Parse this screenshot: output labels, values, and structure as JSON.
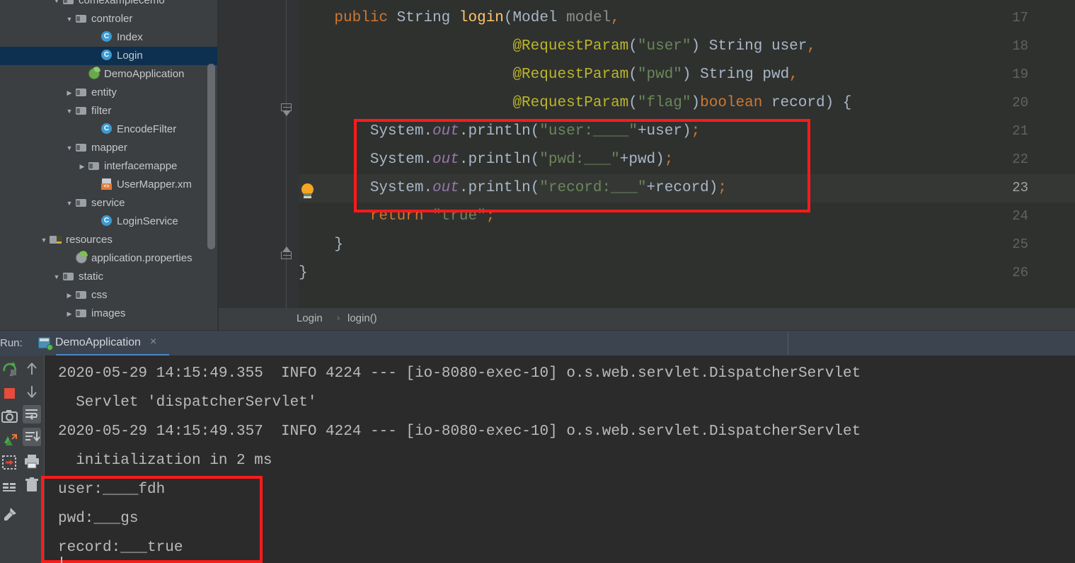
{
  "ide": {
    "theme_bg": "#3c3f41",
    "editor_bg": "#2f312f",
    "console_bg": "#2b2b2b",
    "selection_bg": "#0d3050",
    "accent": "#4a88c7",
    "highlight_box_color": "#ff1a1a"
  },
  "project_tree": [
    {
      "indent": 4,
      "arrow": "▼",
      "icon": "folder-icon",
      "label": "comexamplecemo",
      "partial": true,
      "selected": false
    },
    {
      "indent": 5,
      "arrow": "▼",
      "icon": "folder-icon",
      "label": "controler",
      "selected": false
    },
    {
      "indent": 7,
      "arrow": "",
      "icon": "class-icon",
      "label": "Index",
      "selected": false
    },
    {
      "indent": 7,
      "arrow": "",
      "icon": "class-icon",
      "label": "Login",
      "selected": true
    },
    {
      "indent": 6,
      "arrow": "",
      "icon": "spring-app-icon",
      "label": "DemoApplication",
      "selected": false
    },
    {
      "indent": 5,
      "arrow": "▶",
      "icon": "folder-icon",
      "label": "entity",
      "selected": false
    },
    {
      "indent": 5,
      "arrow": "▼",
      "icon": "folder-icon",
      "label": "filter",
      "selected": false
    },
    {
      "indent": 7,
      "arrow": "",
      "icon": "class-icon",
      "label": "EncodeFilter",
      "selected": false
    },
    {
      "indent": 5,
      "arrow": "▼",
      "icon": "folder-icon",
      "label": "mapper",
      "selected": false
    },
    {
      "indent": 6,
      "arrow": "▶",
      "icon": "folder-icon",
      "label": "interfacemappe",
      "selected": false
    },
    {
      "indent": 7,
      "arrow": "",
      "icon": "xml-file-icon",
      "label": "UserMapper.xm",
      "selected": false
    },
    {
      "indent": 5,
      "arrow": "▼",
      "icon": "folder-icon",
      "label": "service",
      "selected": false
    },
    {
      "indent": 7,
      "arrow": "",
      "icon": "class-icon",
      "label": "LoginService",
      "selected": false
    },
    {
      "indent": 3,
      "arrow": "▼",
      "icon": "resources-icon",
      "label": "resources",
      "selected": false
    },
    {
      "indent": 5,
      "arrow": "",
      "icon": "properties-icon",
      "label": "application.properties",
      "selected": false
    },
    {
      "indent": 4,
      "arrow": "▼",
      "icon": "folder-icon",
      "label": "static",
      "selected": false
    },
    {
      "indent": 5,
      "arrow": "▶",
      "icon": "folder-icon",
      "label": "css",
      "selected": false
    },
    {
      "indent": 5,
      "arrow": "▶",
      "icon": "folder-icon",
      "label": "images",
      "selected": false
    }
  ],
  "editor": {
    "first_visible_line": 17,
    "current_line": 23,
    "lines": [
      {
        "n": 17,
        "segments": [
          {
            "t": "    ",
            "c": "plain"
          },
          {
            "t": "public",
            "c": "kw"
          },
          {
            "t": " ",
            "c": "plain"
          },
          {
            "t": "String",
            "c": "type"
          },
          {
            "t": " ",
            "c": "plain"
          },
          {
            "t": "login",
            "c": "meth"
          },
          {
            "t": "(",
            "c": "punct"
          },
          {
            "t": "Model",
            "c": "type"
          },
          {
            "t": " ",
            "c": "plain"
          },
          {
            "t": "model",
            "c": "param"
          },
          {
            "t": ",",
            "c": "semi"
          }
        ]
      },
      {
        "n": 18,
        "segments": [
          {
            "t": "                        ",
            "c": "plain"
          },
          {
            "t": "@RequestParam",
            "c": "anno"
          },
          {
            "t": "(",
            "c": "punct"
          },
          {
            "t": "\"user\"",
            "c": "str"
          },
          {
            "t": ")",
            "c": "punct"
          },
          {
            "t": " ",
            "c": "plain"
          },
          {
            "t": "String",
            "c": "type"
          },
          {
            "t": " ",
            "c": "plain"
          },
          {
            "t": "user",
            "c": "plain"
          },
          {
            "t": ",",
            "c": "semi"
          }
        ]
      },
      {
        "n": 19,
        "segments": [
          {
            "t": "                        ",
            "c": "plain"
          },
          {
            "t": "@RequestParam",
            "c": "anno"
          },
          {
            "t": "(",
            "c": "punct"
          },
          {
            "t": "\"pwd\"",
            "c": "str"
          },
          {
            "t": ")",
            "c": "punct"
          },
          {
            "t": " ",
            "c": "plain"
          },
          {
            "t": "String",
            "c": "type"
          },
          {
            "t": " ",
            "c": "plain"
          },
          {
            "t": "pwd",
            "c": "plain"
          },
          {
            "t": ",",
            "c": "semi"
          }
        ]
      },
      {
        "n": 20,
        "segments": [
          {
            "t": "                        ",
            "c": "plain"
          },
          {
            "t": "@RequestParam",
            "c": "anno"
          },
          {
            "t": "(",
            "c": "punct"
          },
          {
            "t": "\"flag\"",
            "c": "str"
          },
          {
            "t": ")",
            "c": "punct"
          },
          {
            "t": "boolean",
            "c": "kw"
          },
          {
            "t": " ",
            "c": "plain"
          },
          {
            "t": "record",
            "c": "plain"
          },
          {
            "t": ") {",
            "c": "punct"
          }
        ]
      },
      {
        "n": 21,
        "segments": [
          {
            "t": "        ",
            "c": "plain"
          },
          {
            "t": "System",
            "c": "plain"
          },
          {
            "t": ".",
            "c": "punct"
          },
          {
            "t": "out",
            "c": "fieldi"
          },
          {
            "t": ".",
            "c": "punct"
          },
          {
            "t": "println",
            "c": "plain"
          },
          {
            "t": "(",
            "c": "punct"
          },
          {
            "t": "\"user:____\"",
            "c": "str"
          },
          {
            "t": "+",
            "c": "plain"
          },
          {
            "t": "user",
            "c": "plain"
          },
          {
            "t": ")",
            "c": "punct"
          },
          {
            "t": ";",
            "c": "semi"
          }
        ]
      },
      {
        "n": 22,
        "segments": [
          {
            "t": "        ",
            "c": "plain"
          },
          {
            "t": "System",
            "c": "plain"
          },
          {
            "t": ".",
            "c": "punct"
          },
          {
            "t": "out",
            "c": "fieldi"
          },
          {
            "t": ".",
            "c": "punct"
          },
          {
            "t": "println",
            "c": "plain"
          },
          {
            "t": "(",
            "c": "punct"
          },
          {
            "t": "\"pwd:___\"",
            "c": "str"
          },
          {
            "t": "+",
            "c": "plain"
          },
          {
            "t": "pwd",
            "c": "plain"
          },
          {
            "t": ")",
            "c": "punct"
          },
          {
            "t": ";",
            "c": "semi"
          }
        ]
      },
      {
        "n": 23,
        "segments": [
          {
            "t": "        ",
            "c": "plain"
          },
          {
            "t": "System",
            "c": "plain"
          },
          {
            "t": ".",
            "c": "punct"
          },
          {
            "t": "out",
            "c": "fieldi"
          },
          {
            "t": ".",
            "c": "punct"
          },
          {
            "t": "println",
            "c": "plain"
          },
          {
            "t": "(",
            "c": "punct"
          },
          {
            "t": "\"record:___\"",
            "c": "str"
          },
          {
            "t": "+",
            "c": "plain"
          },
          {
            "t": "record",
            "c": "plain"
          },
          {
            "t": ")",
            "c": "punct"
          },
          {
            "t": ";",
            "c": "semi"
          }
        ]
      },
      {
        "n": 24,
        "segments": [
          {
            "t": "        ",
            "c": "plain"
          },
          {
            "t": "return",
            "c": "kw"
          },
          {
            "t": " ",
            "c": "plain"
          },
          {
            "t": "\"true\"",
            "c": "str"
          },
          {
            "t": ";",
            "c": "semi"
          }
        ]
      },
      {
        "n": 25,
        "segments": [
          {
            "t": "    }",
            "c": "punct"
          }
        ]
      },
      {
        "n": 26,
        "segments": [
          {
            "t": "}",
            "c": "punct"
          }
        ]
      }
    ]
  },
  "breadcrumb": {
    "class": "Login",
    "separator": "›",
    "method": "login()"
  },
  "run_panel": {
    "label": "Run:",
    "tab_title": "DemoApplication",
    "tab_close": "×",
    "toolbar_left": [
      "rerun-icon",
      "stop-icon",
      "screenshot-icon",
      "attach-icon",
      "export-icon",
      "layout-icon",
      "pin-icon"
    ],
    "toolbar_right": [
      "scroll-up-icon",
      "scroll-down-icon",
      "soft-wrap-icon",
      "scroll-to-end-icon",
      "print-icon",
      "clear-all-icon"
    ]
  },
  "console": {
    "lines": [
      "2020-05-29 14:15:49.355  INFO 4224 --- [io-8080-exec-10] o.s.web.servlet.DispatcherServlet",
      "  Servlet 'dispatcherServlet'",
      "2020-05-29 14:15:49.357  INFO 4224 --- [io-8080-exec-10] o.s.web.servlet.DispatcherServlet",
      "  initialization in 2 ms",
      "user:____fdh",
      "pwd:___gs",
      "record:___true"
    ]
  },
  "annotations": {
    "code_box_note": "red rectangle around println statements lines 21-23",
    "console_box_note": "red rectangle around console output lines user/pwd/record"
  }
}
